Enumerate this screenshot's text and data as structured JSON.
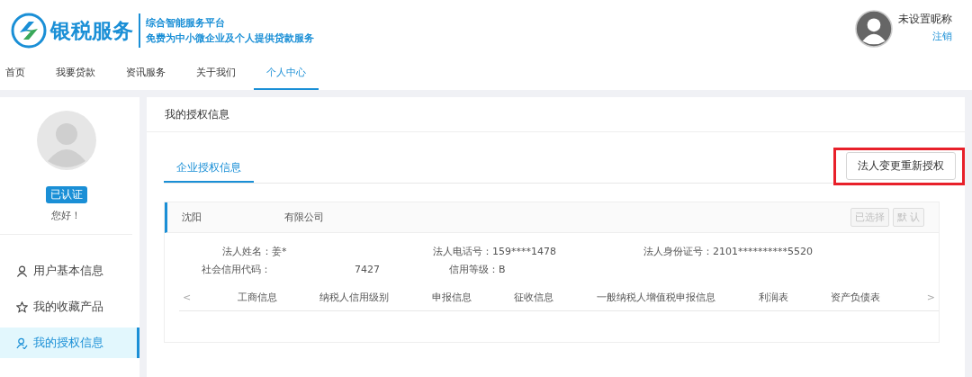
{
  "header": {
    "brand": "银税服务",
    "tagline_1": "综合智能服务平台",
    "tagline_2": "免费为中小微企业及个人提供贷款服务",
    "user_name": "未设置昵称",
    "logout": "注销"
  },
  "nav": [
    {
      "label": "首页",
      "selected": false
    },
    {
      "label": "我要贷款",
      "selected": false
    },
    {
      "label": "资讯服务",
      "selected": false
    },
    {
      "label": "关于我们",
      "selected": false
    },
    {
      "label": "个人中心",
      "selected": true
    }
  ],
  "sidebar": {
    "badge": "已认证",
    "greeting": "您好！",
    "items": [
      {
        "label": "用户基本信息",
        "kind": "user",
        "selected": false
      },
      {
        "label": "我的收藏产品",
        "kind": "star",
        "selected": false
      },
      {
        "label": "我的授权信息",
        "kind": "auth",
        "selected": true
      }
    ]
  },
  "main": {
    "title": "我的授权信息",
    "tabs": [
      {
        "label": "企业授权信息",
        "selected": true
      }
    ],
    "reauth_button": "法人变更重新授权",
    "highlighted": true,
    "company": {
      "name_start": "沈阳",
      "name_end": "有限公司",
      "actions": [
        {
          "label": "已选择",
          "disabled": true
        },
        {
          "label": "默 认",
          "disabled": true
        }
      ],
      "fields": [
        {
          "label": "法人姓名：",
          "value": "姜*"
        },
        {
          "label": "法人电话号：",
          "value": "159****1478"
        },
        {
          "label": "法人身份证号：",
          "value": "2101**********5520"
        },
        {
          "label": "社会信用代码：",
          "value": "7427"
        },
        {
          "label": "信用等级：",
          "value": "B"
        }
      ],
      "prev": "<",
      "next": ">",
      "info_tabs": [
        {
          "label": "工商信息"
        },
        {
          "label": "纳税人信用级别"
        },
        {
          "label": "申报信息"
        },
        {
          "label": "征收信息"
        },
        {
          "label": "一般纳税人增值税申报信息"
        },
        {
          "label": "利润表"
        },
        {
          "label": "资产负债表"
        }
      ]
    }
  }
}
